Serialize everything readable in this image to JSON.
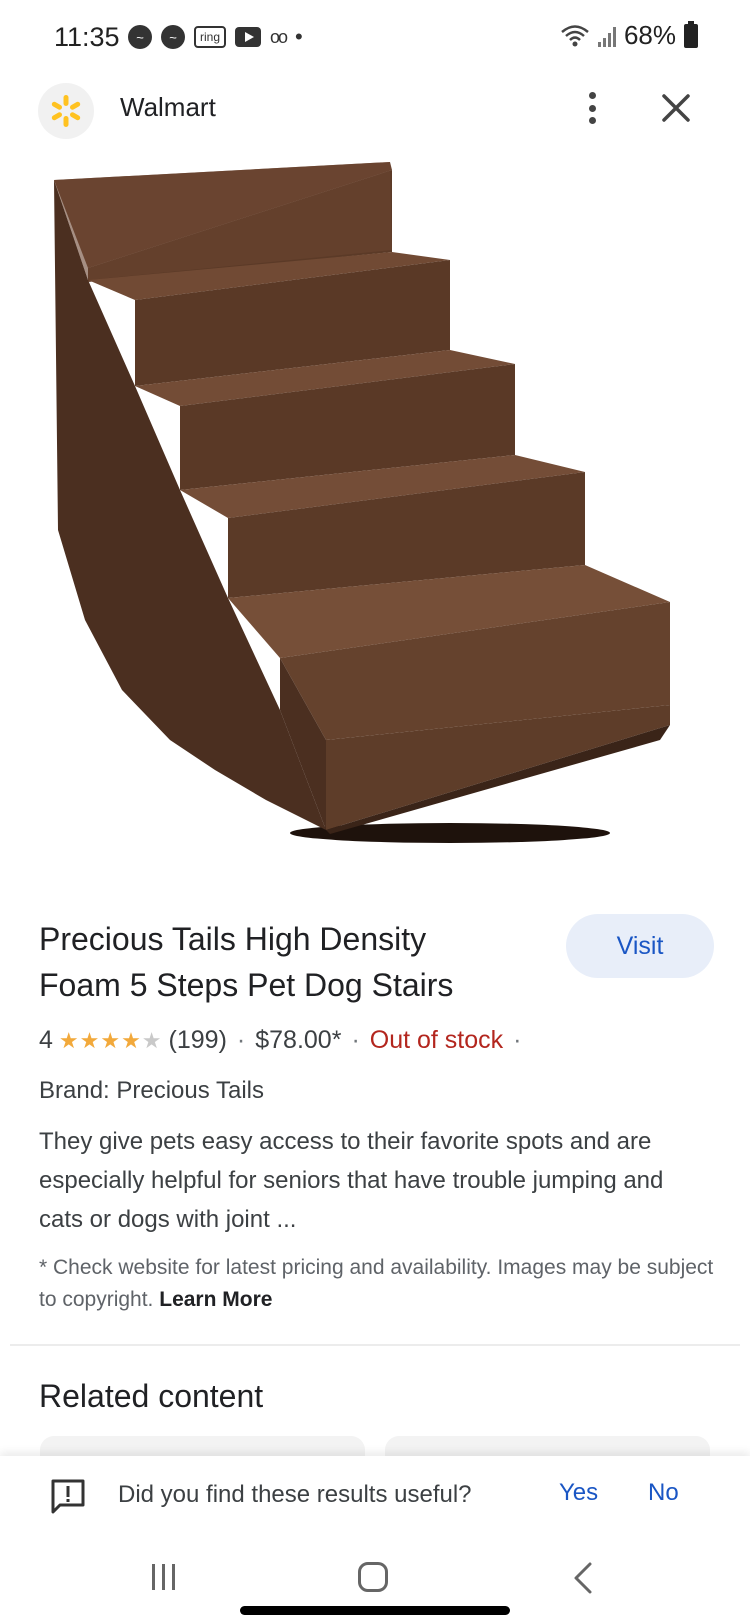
{
  "status_bar": {
    "time": "11:35",
    "ring_label": "ring",
    "battery": "68%"
  },
  "header": {
    "site_name": "Walmart",
    "brand_color": "#ffc220"
  },
  "product": {
    "title": "Precious Tails High Density Foam 5 Steps Pet Dog Stairs",
    "visit_label": "Visit",
    "rating": "4",
    "rating_value": 4,
    "rating_max": 5,
    "reviews": "(199)",
    "price": "$78.00*",
    "stock_status": "Out of stock",
    "brand": "Brand: Precious Tails",
    "description": "They give pets easy access to their favorite spots and are especially helpful for seniors that have trouble jumping and cats or dogs with joint ...",
    "disclaimer": "* Check website for latest pricing and availability. Images may be subject to copyright.",
    "learn_more": "Learn More",
    "image_color": "#5a3a27"
  },
  "related": {
    "heading": "Related content"
  },
  "feedback": {
    "question": "Did you find these results useful?",
    "yes": "Yes",
    "no": "No"
  }
}
